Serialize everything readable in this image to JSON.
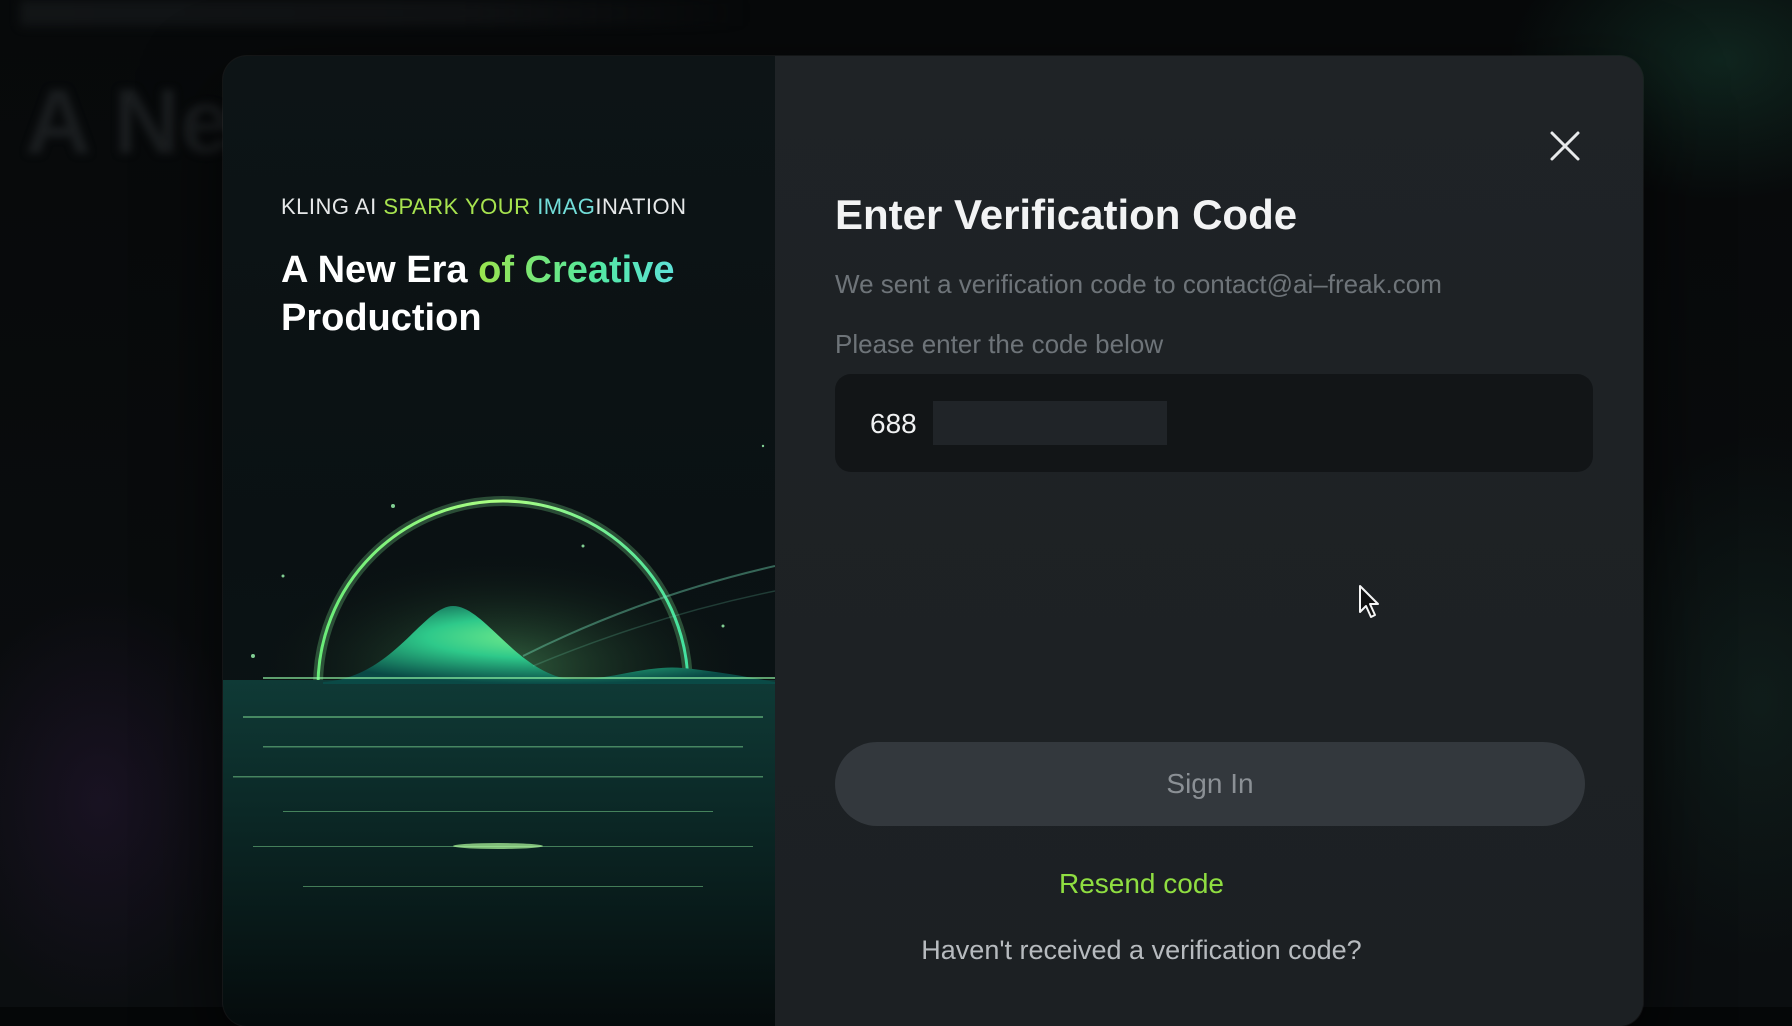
{
  "modal": {
    "tagline": {
      "part1": "KLING AI ",
      "part2": "SPARK ",
      "part3": "YOUR ",
      "part4": "IMAG",
      "part5": "INATION"
    },
    "headline": {
      "part1": "A New Era ",
      "accent": "of Creative",
      "part2": "Production"
    },
    "title": "Enter Verification Code",
    "subtitle": "We sent a verification code to contact@ai–freak.com",
    "instruction": "Please enter the code below",
    "code_input": {
      "value": "688",
      "visible_partial": "688!"
    },
    "sign_in_label": "Sign In",
    "resend_label": "Resend code",
    "not_received_label": "Haven't received a verification code?"
  },
  "icons": {
    "close": "close-icon",
    "cursor": "mouse-pointer-icon"
  },
  "colors": {
    "accent_green": "#8fde41",
    "button_bg": "#33383d",
    "panel_bg": "#1d2124"
  }
}
